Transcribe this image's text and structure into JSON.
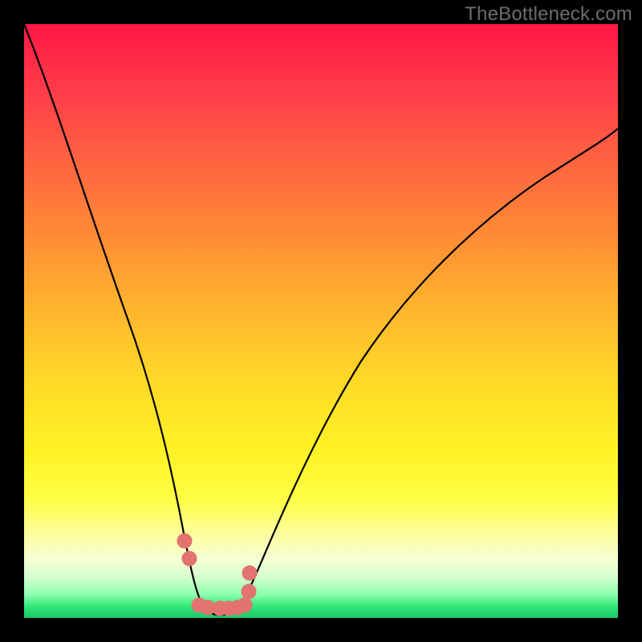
{
  "watermark": "TheBottleneck.com",
  "chart_data": {
    "type": "line",
    "title": "",
    "xlabel": "",
    "ylabel": "",
    "xlim": [
      0,
      100
    ],
    "ylim": [
      0,
      100
    ],
    "series": [
      {
        "name": "bottleneck-curve",
        "x": [
          0,
          5,
          10,
          15,
          20,
          24,
          27,
          30,
          32,
          34,
          36,
          38,
          42,
          47,
          53,
          60,
          68,
          78,
          90,
          100
        ],
        "y": [
          100,
          85,
          70,
          55,
          40,
          25,
          13,
          6,
          2,
          1,
          1,
          2,
          7,
          17,
          30,
          43,
          55,
          67,
          77,
          83
        ]
      }
    ],
    "markers": {
      "name": "highlight-dots",
      "color": "#e2736e",
      "points": [
        {
          "x": 27.0,
          "y": 13.0
        },
        {
          "x": 27.8,
          "y": 10.0
        },
        {
          "x": 29.5,
          "y": 2.2
        },
        {
          "x": 31.0,
          "y": 1.8
        },
        {
          "x": 33.0,
          "y": 1.6
        },
        {
          "x": 34.5,
          "y": 1.6
        },
        {
          "x": 36.0,
          "y": 1.8
        },
        {
          "x": 37.2,
          "y": 2.2
        },
        {
          "x": 37.8,
          "y": 4.5
        },
        {
          "x": 38.0,
          "y": 7.5
        }
      ]
    },
    "background_gradient": {
      "top": "#ff1745",
      "mid": "#fff325",
      "bottom": "#18c867"
    }
  }
}
